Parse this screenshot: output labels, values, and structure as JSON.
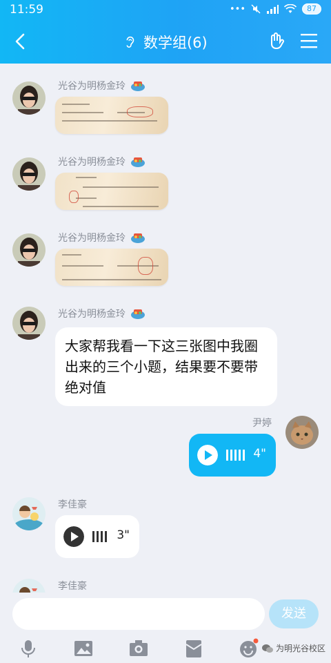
{
  "status": {
    "time": "11:59",
    "battery": "87"
  },
  "header": {
    "title": "数学组(6)"
  },
  "messages": [
    {
      "sender": "光谷为明杨金玲",
      "type": "image"
    },
    {
      "sender": "光谷为明杨金玲",
      "type": "image"
    },
    {
      "sender": "光谷为明杨金玲",
      "type": "image"
    },
    {
      "sender": "光谷为明杨金玲",
      "type": "text",
      "text": "大家帮我看一下这三张图中我圈出来的三个小题，结果要不要带绝对值"
    },
    {
      "sender": "尹婷",
      "type": "voice",
      "duration": "4\""
    },
    {
      "sender": "李佳豪",
      "type": "voice",
      "duration": "3\""
    },
    {
      "sender": "李佳豪",
      "type": "partial"
    }
  ],
  "input": {
    "send_label": "发送"
  },
  "watermark": {
    "text": "为明光谷校区"
  },
  "colors": {
    "accent": "#12b7f5",
    "background": "#eef0f6"
  },
  "tools": [
    "mic-icon",
    "picture-icon",
    "camera-icon",
    "red-packet-icon",
    "emoji-icon",
    "plus-icon"
  ]
}
